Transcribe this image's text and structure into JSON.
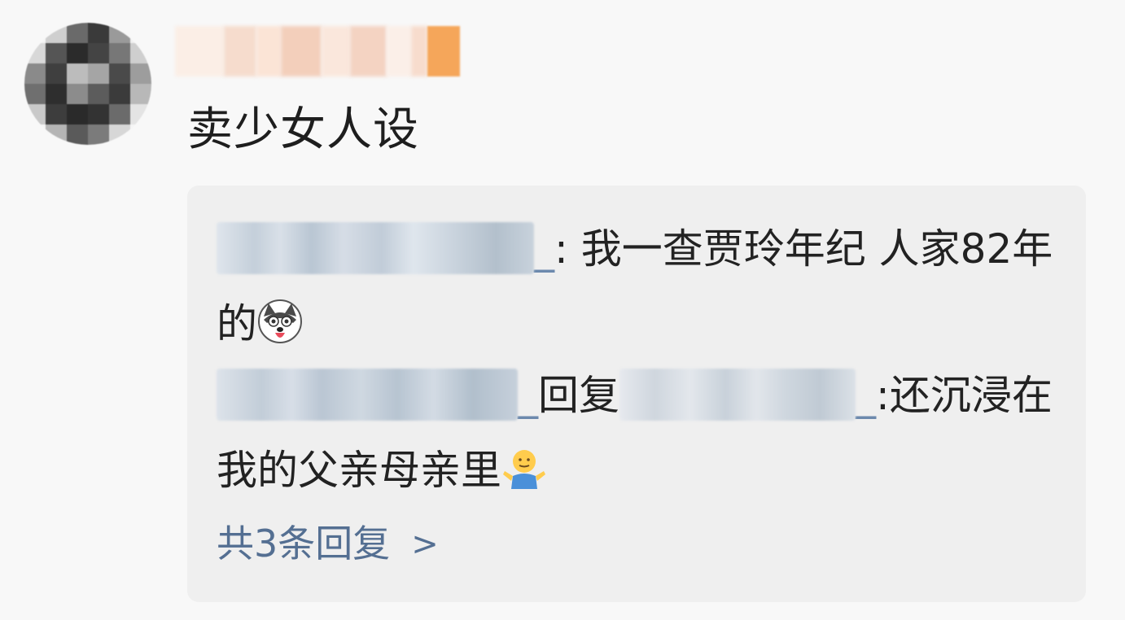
{
  "comment": {
    "text": "卖少女人设"
  },
  "replies": [
    {
      "author_tail": "_",
      "separator": ":",
      "text": "我一查贾玲年纪 人家82年的",
      "emoji": "husky-dog-emoji"
    },
    {
      "author_tail": "_",
      "reply_word": "回复",
      "target_tail": "_",
      "separator": ":",
      "text": "还沉浸在我的父亲母亲里",
      "emoji": "shrug-emoji"
    }
  ],
  "more_replies": {
    "label": "共3条回复",
    "chevron": ">"
  },
  "colors": {
    "link": "#546f92",
    "reply_box": "#efefef",
    "text": "#222222"
  }
}
